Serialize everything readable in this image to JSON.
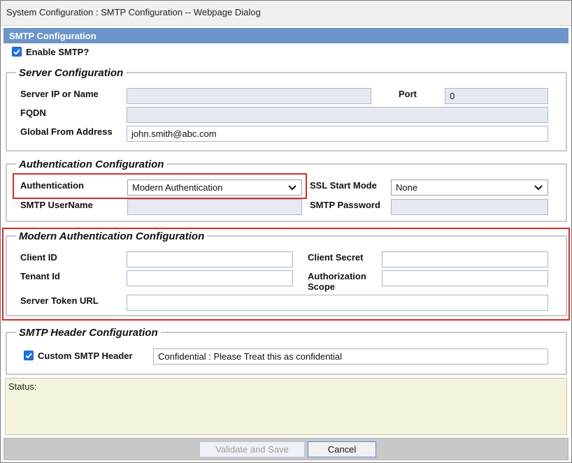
{
  "window": {
    "title": "System Configuration : SMTP Configuration -- Webpage Dialog"
  },
  "header": {
    "title": "SMTP Configuration"
  },
  "enable_smtp": {
    "label": "Enable SMTP?",
    "checked": true
  },
  "server": {
    "title": "Server Configuration",
    "ip_label": "Server IP or Name",
    "ip_value": "",
    "port_label": "Port",
    "port_value": "0",
    "fqdn_label": "FQDN",
    "fqdn_value": "",
    "from_label": "Global From Address",
    "from_value": "john.smith@abc.com"
  },
  "auth": {
    "title": "Authentication Configuration",
    "auth_label": "Authentication",
    "auth_value": "Modern Authentication",
    "ssl_label": "SSL Start Mode",
    "ssl_value": "None",
    "user_label": "SMTP UserName",
    "user_value": "",
    "pass_label": "SMTP Password",
    "pass_value": ""
  },
  "modern": {
    "title": "Modern Authentication Configuration",
    "client_id_label": "Client ID",
    "client_id_value": "",
    "client_secret_label": "Client Secret",
    "client_secret_value": "",
    "tenant_label": "Tenant Id",
    "tenant_value": "",
    "scope_label_1": "Authorization",
    "scope_label_2": "Scope",
    "scope_value": "",
    "token_url_label": "Server Token URL",
    "token_url_value": ""
  },
  "header_config": {
    "title": "SMTP Header Configuration",
    "custom_label": "Custom SMTP Header",
    "custom_checked": true,
    "custom_value": "Confidential : Please Treat this as confidential"
  },
  "status": {
    "label": "Status:"
  },
  "footer": {
    "validate_label": "Validate and Save",
    "cancel_label": "Cancel"
  },
  "colors": {
    "header_bg": "#6b94c8",
    "highlight": "#d92b2b",
    "status_bg": "#f4f4dc",
    "checkbox": "#1a73e8"
  }
}
